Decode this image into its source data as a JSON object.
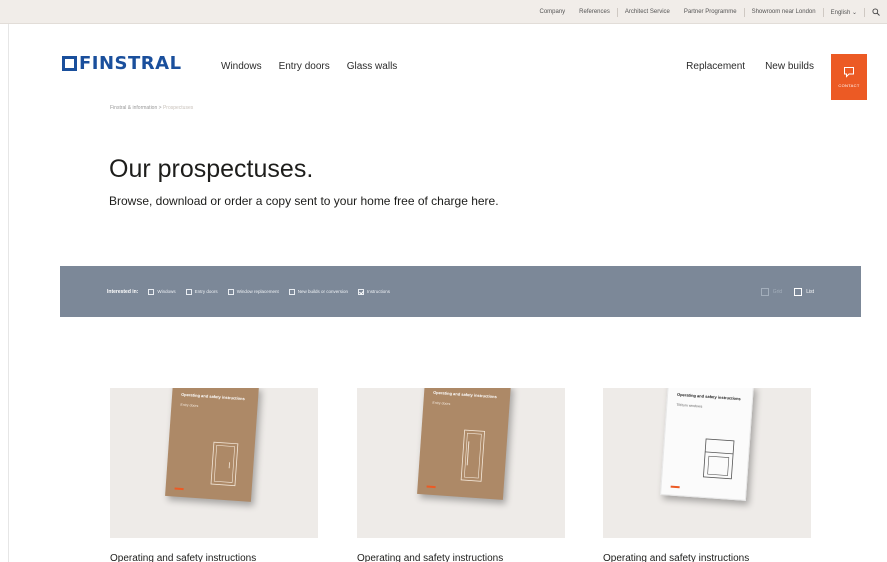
{
  "utility_nav": {
    "links": [
      "Company",
      "References",
      "Architect Service",
      "Partner Programme",
      "Showroom near London",
      "English"
    ]
  },
  "brand": {
    "name": "FINSTRAL",
    "color": "#1a4f9c"
  },
  "main_nav": {
    "items": [
      "Windows",
      "Entry doors",
      "Glass walls"
    ]
  },
  "side_nav": {
    "items": [
      "Replacement",
      "New builds"
    ]
  },
  "contact": {
    "label": "CONTACT",
    "color": "#ec5a24"
  },
  "breadcrumb": {
    "parent": "Finstral & information",
    "separator": ">",
    "current": "Prospectuses"
  },
  "page": {
    "title": "Our prospectuses.",
    "intro": "Browse, download or order a copy sent to your home free of charge here."
  },
  "filter": {
    "title": "Interested in:",
    "options": [
      {
        "label": "Windows",
        "checked": false
      },
      {
        "label": "Entry doors",
        "checked": false
      },
      {
        "label": "Window replacement",
        "checked": false
      },
      {
        "label": "New builds or conversion",
        "checked": false
      },
      {
        "label": "Instructions",
        "checked": true
      }
    ],
    "views": [
      {
        "label": "Grid",
        "active": false
      },
      {
        "label": "List",
        "active": true
      }
    ],
    "bar_color": "#7c8898"
  },
  "cards": [
    {
      "booklet_title": "Operating and safety instructions",
      "booklet_sub": "Entry doors",
      "caption": "Operating and safety instructions",
      "cover": "brown"
    },
    {
      "booklet_title": "Operating and safety instructions",
      "booklet_sub": "Entry doors",
      "caption": "Operating and safety instructions",
      "cover": "brown"
    },
    {
      "booklet_title": "Operating and safety instructions",
      "booklet_sub": "Tilt/turn windows",
      "caption": "Operating and safety instructions",
      "cover": "white"
    }
  ]
}
